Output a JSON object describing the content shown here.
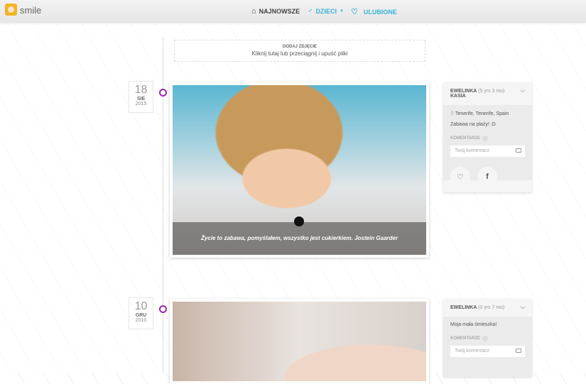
{
  "header": {
    "brand": "smile",
    "nav": [
      {
        "label": "NAJNOWSZE",
        "icon": "home-icon"
      },
      {
        "label": "DZIECI",
        "icon": "child-icon"
      },
      {
        "label": "ULUBIONE",
        "icon": "heart-icon"
      }
    ],
    "accent": "#36b4d6"
  },
  "upload": {
    "title": "DODAJ ZDJĘCIE",
    "subtitle": "Kliknij tutaj lub przeciągnij i upuść pliki"
  },
  "posts": [
    {
      "day": "18",
      "month": "SIE",
      "year": "2015",
      "caption": "Życie to zabawa, pomyślałem, wszystko jest cukierkiem. Jostein Gaarder",
      "name": "EWELINKA",
      "age": "(5 yrs 3 mo)",
      "name2": "KASIA",
      "location": "Tenerife, Tenerife, Spain",
      "text": "Zabawa na plaży! :D",
      "comments_label": "KOMENTARZE",
      "comment_placeholder": "Twój komentarz"
    },
    {
      "day": "10",
      "month": "GRU",
      "year": "2010",
      "name": "EWELINKA",
      "age": "(0 yrs 7 mo)",
      "text": "Moja mała śmieszka!",
      "comments_label": "KOMENTARZE",
      "comment_placeholder": "Twój komentarz"
    }
  ]
}
